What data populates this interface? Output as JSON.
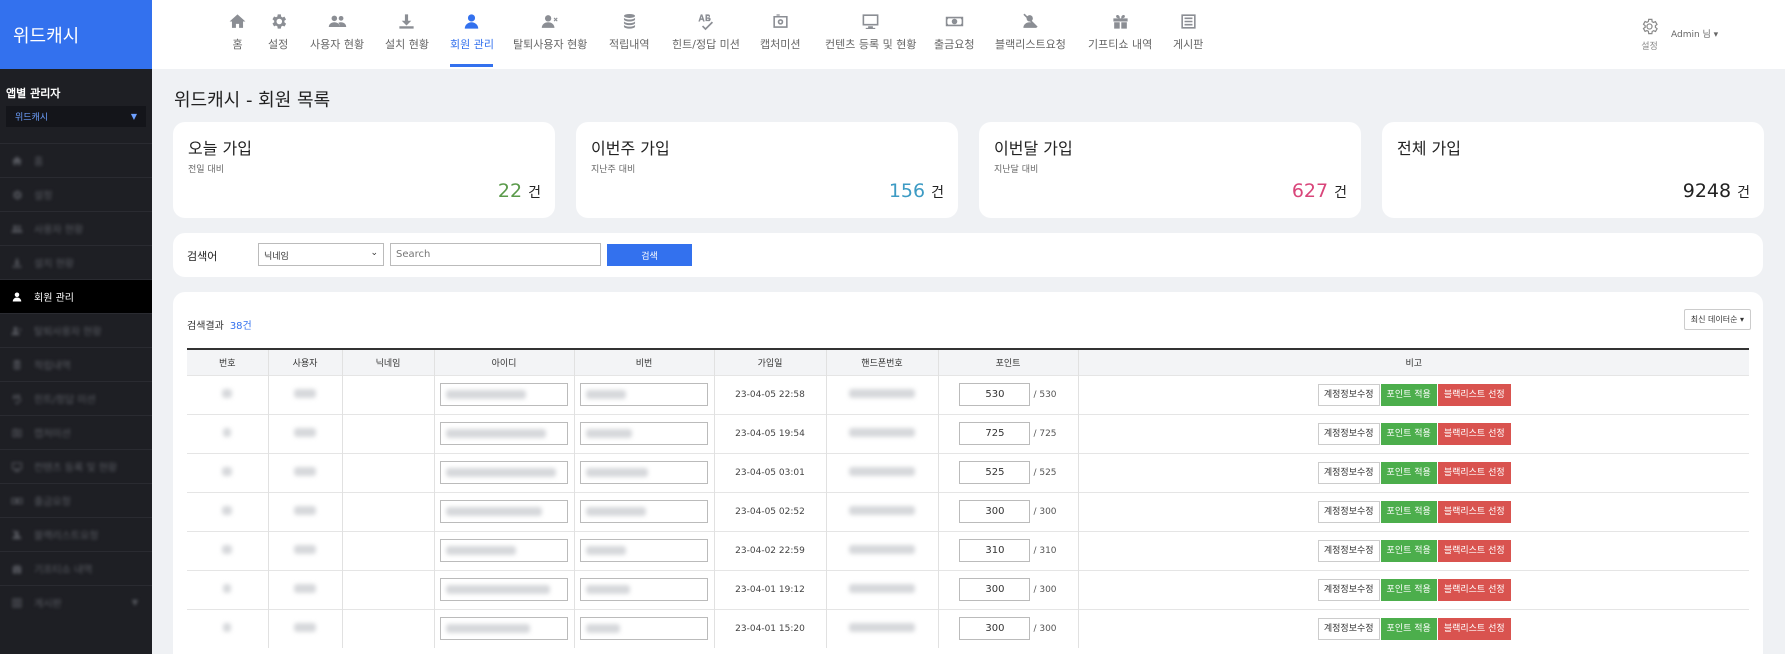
{
  "brand": {
    "title": "위드캐시"
  },
  "app": {
    "label": "앱별 관리자",
    "selected": "위드캐시"
  },
  "sidebar": {
    "items": [
      {
        "label": "홈",
        "icon": "home-icon",
        "active": false
      },
      {
        "label": "설정",
        "icon": "gear-icon",
        "active": false
      },
      {
        "label": "사용자 현황",
        "icon": "users-icon",
        "active": false
      },
      {
        "label": "설치 현황",
        "icon": "download-icon",
        "active": false
      },
      {
        "label": "회원 관리",
        "icon": "user-icon",
        "active": true
      },
      {
        "label": "탈퇴사용자 현황",
        "icon": "user-remove-icon",
        "active": false
      },
      {
        "label": "적립내역",
        "icon": "coins-icon",
        "active": false
      },
      {
        "label": "힌트/정답 미션",
        "icon": "spellcheck-icon",
        "active": false
      },
      {
        "label": "캡처미션",
        "icon": "camera-icon",
        "active": false
      },
      {
        "label": "컨텐츠 등록 및 현황",
        "icon": "monitor-icon",
        "active": false
      },
      {
        "label": "출금요청",
        "icon": "money-icon",
        "active": false
      },
      {
        "label": "블랙리스트요청",
        "icon": "user-block-icon",
        "active": false
      },
      {
        "label": "기프티쇼 내역",
        "icon": "gift-icon",
        "active": false
      },
      {
        "label": "게시판",
        "icon": "list-icon",
        "active": false,
        "dropdown": true
      }
    ]
  },
  "topnav": {
    "items": [
      {
        "label": "홈",
        "icon": "home-icon"
      },
      {
        "label": "설정",
        "icon": "gear-icon"
      },
      {
        "label": "사용자 현황",
        "icon": "users-icon"
      },
      {
        "label": "설치 현황",
        "icon": "download-icon"
      },
      {
        "label": "회원 관리",
        "icon": "user-icon"
      },
      {
        "label": "탈퇴사용자 현황",
        "icon": "user-remove-icon"
      },
      {
        "label": "적립내역",
        "icon": "coins-icon"
      },
      {
        "label": "힌트/정답 미션",
        "icon": "spellcheck-icon"
      },
      {
        "label": "캡처미션",
        "icon": "camera-icon"
      },
      {
        "label": "컨텐츠 등록 및 현황",
        "icon": "monitor-icon"
      },
      {
        "label": "출금요청",
        "icon": "money-icon"
      },
      {
        "label": "블랙리스트요청",
        "icon": "user-block-icon"
      },
      {
        "label": "기프티쇼 내역",
        "icon": "gift-icon"
      },
      {
        "label": "게시판",
        "icon": "list-icon"
      }
    ],
    "active_index": 4,
    "settings_label": "설정",
    "admin_label": "Admin 님 ▾"
  },
  "page": {
    "title": "위드캐시 - 회원 목록"
  },
  "stats": [
    {
      "title": "오늘 가입",
      "sub": "전일 대비",
      "value": "22",
      "unit": "건",
      "color": "#5a9a4a"
    },
    {
      "title": "이번주 가입",
      "sub": "지난주 대비",
      "value": "156",
      "unit": "건",
      "color": "#3d9bc4"
    },
    {
      "title": "이번달 가입",
      "sub": "지난달 대비",
      "value": "627",
      "unit": "건",
      "color": "#d9457a"
    },
    {
      "title": "전체 가입",
      "sub": "",
      "value": "9248",
      "unit": "건",
      "color": "#222222"
    }
  ],
  "search": {
    "label": "검색어",
    "field_selected": "닉네임",
    "placeholder": "Search",
    "button": "검색"
  },
  "results": {
    "label": "검색결과",
    "count": "38건",
    "sort_label": "최신 데이터순 ▾",
    "columns": [
      "번호",
      "사용자",
      "닉네임",
      "아이디",
      "비번",
      "가입일",
      "핸드폰번호",
      "포인트",
      "비고"
    ],
    "rows": [
      {
        "joined": "23-04-05 22:58",
        "points": "530",
        "points_total": "/ 530"
      },
      {
        "joined": "23-04-05 19:54",
        "points": "725",
        "points_total": "/ 725"
      },
      {
        "joined": "23-04-05 03:01",
        "points": "525",
        "points_total": "/ 525"
      },
      {
        "joined": "23-04-05 02:52",
        "points": "300",
        "points_total": "/ 300"
      },
      {
        "joined": "23-04-02 22:59",
        "points": "310",
        "points_total": "/ 310"
      },
      {
        "joined": "23-04-01 19:12",
        "points": "300",
        "points_total": "/ 300"
      },
      {
        "joined": "23-04-01 15:20",
        "points": "300",
        "points_total": "/ 300"
      }
    ],
    "actions": {
      "edit": "계정정보수정",
      "apply_points": "포인트 적용",
      "blacklist": "블랙리스트 선정"
    }
  },
  "colors": {
    "accent": "#3371ee",
    "sidebar_bg": "#1e1f24",
    "green": "#4cae4c",
    "red": "#d9534f"
  }
}
